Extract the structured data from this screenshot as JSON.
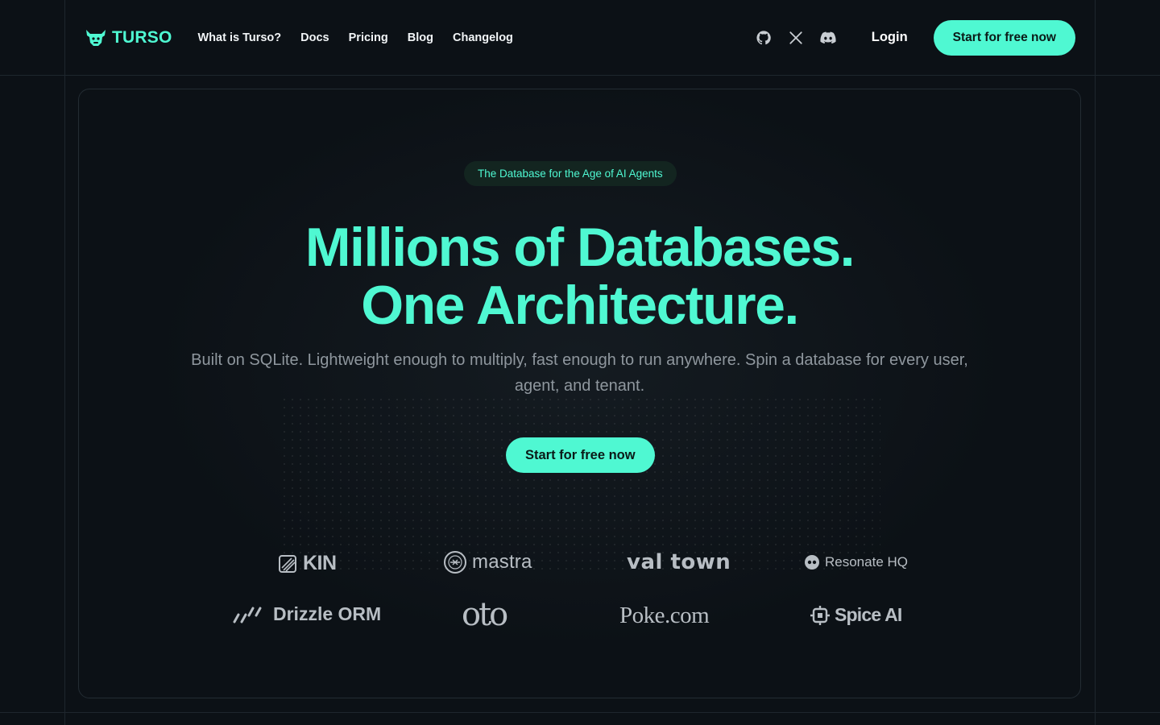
{
  "header": {
    "brand": "TURSO",
    "nav": [
      "What is Turso?",
      "Docs",
      "Pricing",
      "Blog",
      "Changelog"
    ],
    "social_icons": [
      "github-icon",
      "x-icon",
      "discord-icon"
    ],
    "login": "Login",
    "cta": "Start for free now"
  },
  "hero": {
    "badge": "The Database for the Age of AI Agents",
    "headline_line1": "Millions of Databases.",
    "headline_line2": "One Architecture.",
    "subtitle": "Built on SQLite. Lightweight enough to multiply, fast enough to run anywhere. Spin a database for every user, agent, and tenant.",
    "cta": "Start for free now"
  },
  "logos": [
    {
      "name": "KIN",
      "icon": "kin-logo-icon"
    },
    {
      "name": "mastra",
      "icon": "mastra-logo-icon"
    },
    {
      "name": "val town",
      "icon": ""
    },
    {
      "name": "Resonate HQ",
      "icon": "resonate-logo-icon"
    },
    {
      "name": "Drizzle ORM",
      "icon": "drizzle-logo-icon"
    },
    {
      "name": "oto",
      "icon": ""
    },
    {
      "name": "Poke.com",
      "icon": ""
    },
    {
      "name": "Spice AI",
      "icon": "spice-logo-icon"
    }
  ],
  "colors": {
    "accent": "#4ff8d2",
    "background": "#0c1116",
    "muted_text": "#8f979e",
    "logo_gray": "#b8bec4"
  }
}
